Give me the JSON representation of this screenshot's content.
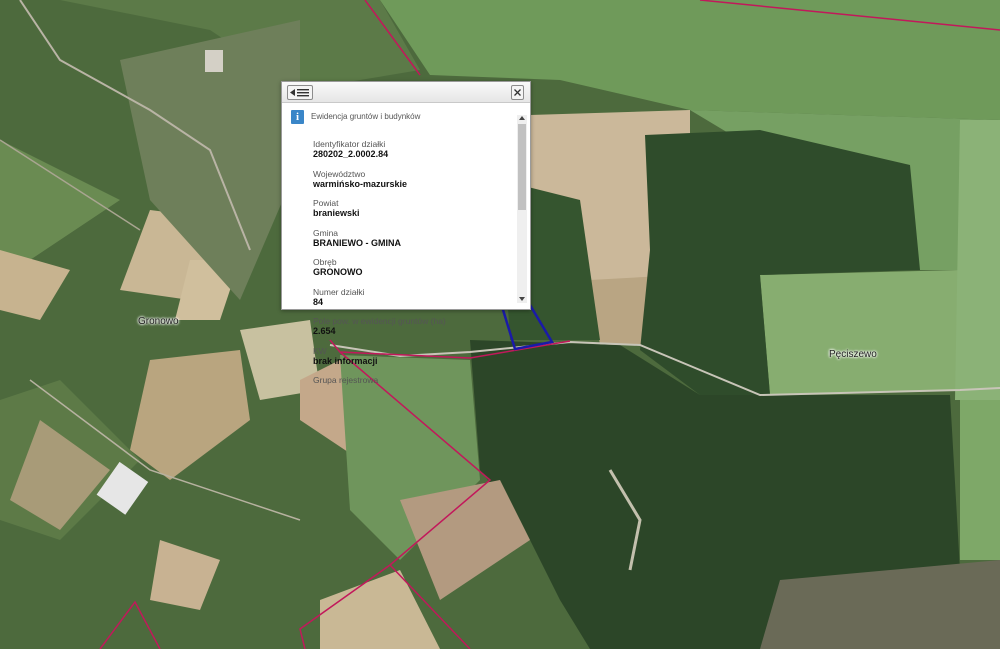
{
  "map": {
    "places": [
      "Gronowo",
      "Pęciszewo"
    ],
    "colors": {
      "parcel_boundary": "#c2185b",
      "selected_parcel": "#1a1aa8",
      "forest": "#2e4a2a",
      "field_light": "#c9b592",
      "field_green": "#7fa36a"
    }
  },
  "popup": {
    "back_icon": "list-back-icon",
    "close_icon": "close-icon",
    "info_icon": "i",
    "layer_title": "Ewidencja gruntów i budynków",
    "attributes": [
      {
        "label": "Identyfikator działki",
        "value": "280202_2.0002.84"
      },
      {
        "label": "Województwo",
        "value": "warmińsko-mazurskie"
      },
      {
        "label": "Powiat",
        "value": "braniewski"
      },
      {
        "label": "Gmina",
        "value": "BRANIEWO - GMINA"
      },
      {
        "label": "Obręb",
        "value": "GRONOWO"
      },
      {
        "label": "Numer działki",
        "value": "84"
      },
      {
        "label": "Pole pow. w ewidencji gruntów (ha)",
        "value": "2.654"
      },
      {
        "label": "KW",
        "value": "brak informacji"
      },
      {
        "label": "Grupa rejestrowa",
        "value": ""
      }
    ]
  }
}
